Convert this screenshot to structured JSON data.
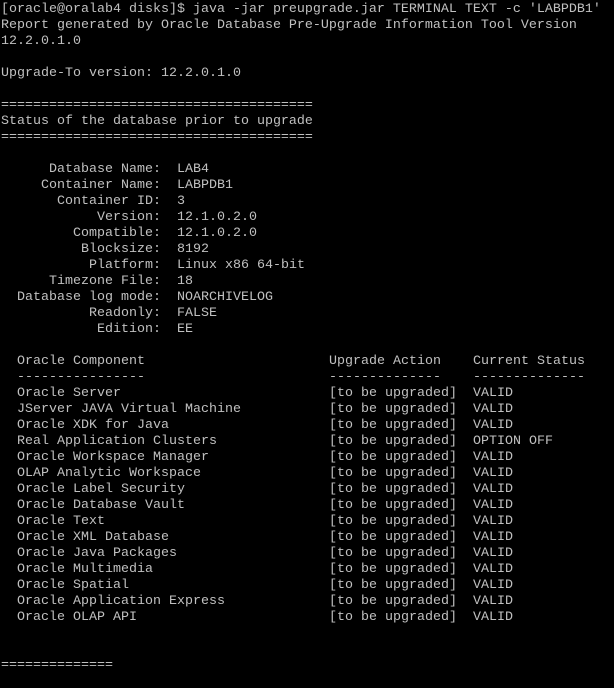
{
  "colors": {
    "background": "#000000",
    "text": "#c0c0c0"
  },
  "header": {
    "command": "[oracle@oralab4 disks]$ java -jar preupgrade.jar TERMINAL TEXT -c 'LABPDB1'",
    "report_line": "Report generated by Oracle Database Pre-Upgrade Information Tool Version",
    "report_version": "12.2.0.1.0",
    "upgrade_to": "Upgrade-To version: 12.2.0.1.0"
  },
  "section": {
    "rule": "=======================================",
    "title": "Status of the database prior to upgrade"
  },
  "database_info": [
    {
      "label": "Database Name:",
      "value": "LAB4"
    },
    {
      "label": "Container Name:",
      "value": "LABPDB1"
    },
    {
      "label": "Container ID:",
      "value": "3"
    },
    {
      "label": "Version:",
      "value": "12.1.0.2.0"
    },
    {
      "label": "Compatible:",
      "value": "12.1.0.2.0"
    },
    {
      "label": "Blocksize:",
      "value": "8192"
    },
    {
      "label": "Platform:",
      "value": "Linux x86 64-bit"
    },
    {
      "label": "Timezone File:",
      "value": "18"
    },
    {
      "label": "Database log mode:",
      "value": "NOARCHIVELOG"
    },
    {
      "label": "Readonly:",
      "value": "FALSE"
    },
    {
      "label": "Edition:",
      "value": "EE"
    }
  ],
  "components": {
    "headers": [
      "Oracle Component",
      "Upgrade Action",
      "Current Status"
    ],
    "underlines": [
      "----------------",
      "--------------",
      "--------------"
    ],
    "rows": [
      [
        "Oracle Server",
        "[to be upgraded]",
        "VALID"
      ],
      [
        "JServer JAVA Virtual Machine",
        "[to be upgraded]",
        "VALID"
      ],
      [
        "Oracle XDK for Java",
        "[to be upgraded]",
        "VALID"
      ],
      [
        "Real Application Clusters",
        "[to be upgraded]",
        "OPTION OFF"
      ],
      [
        "Oracle Workspace Manager",
        "[to be upgraded]",
        "VALID"
      ],
      [
        "OLAP Analytic Workspace",
        "[to be upgraded]",
        "VALID"
      ],
      [
        "Oracle Label Security",
        "[to be upgraded]",
        "VALID"
      ],
      [
        "Oracle Database Vault",
        "[to be upgraded]",
        "VALID"
      ],
      [
        "Oracle Text",
        "[to be upgraded]",
        "VALID"
      ],
      [
        "Oracle XML Database",
        "[to be upgraded]",
        "VALID"
      ],
      [
        "Oracle Java Packages",
        "[to be upgraded]",
        "VALID"
      ],
      [
        "Oracle Multimedia",
        "[to be upgraded]",
        "VALID"
      ],
      [
        "Oracle Spatial",
        "[to be upgraded]",
        "VALID"
      ],
      [
        "Oracle Application Express",
        "[to be upgraded]",
        "VALID"
      ],
      [
        "Oracle OLAP API",
        "[to be upgraded]",
        "VALID"
      ]
    ]
  },
  "footer": {
    "rule": "=============="
  }
}
